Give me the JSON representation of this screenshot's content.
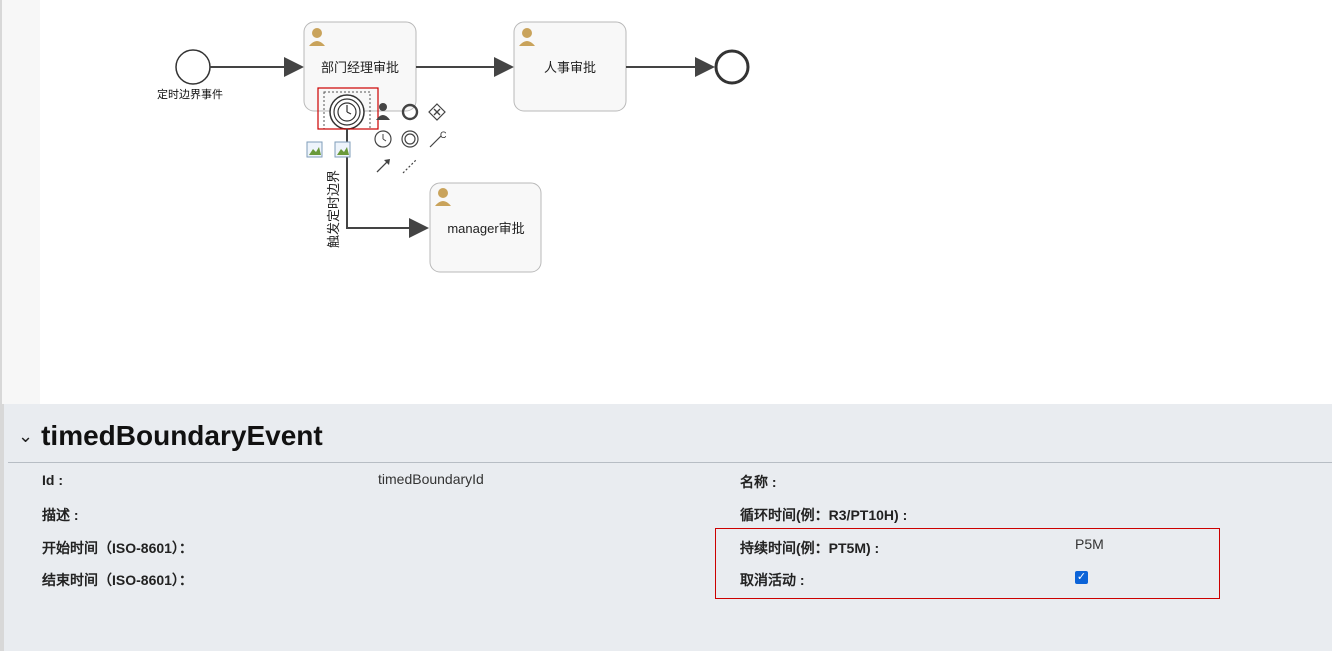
{
  "diagram": {
    "start_event_label": "定时边界事件",
    "task_dept_manager": "部门经理审批",
    "task_hr": "人事审批",
    "task_manager": "manager审批",
    "boundary_flow_label": "触发定时边界",
    "palette_text_annotation_letter": "C"
  },
  "panel": {
    "title": "timedBoundaryEvent",
    "fields": {
      "id_label": "Id :",
      "id_value": "timedBoundaryId",
      "name_label": "名称 :",
      "desc_label": "描述 :",
      "cycle_label": "循环时间(例：R3/PT10H) :",
      "start_label": "开始时间（ISO-8601）：",
      "duration_label": "持续时间(例：PT5M) :",
      "duration_value": "P5M",
      "end_label": "结束时间（ISO-8601）：",
      "cancel_label": "取消活动 :",
      "cancel_checked": true
    }
  },
  "colors": {
    "highlight": "#cc0000",
    "user_icon": "#c9a35b",
    "checkbox": "#0b63d8"
  }
}
